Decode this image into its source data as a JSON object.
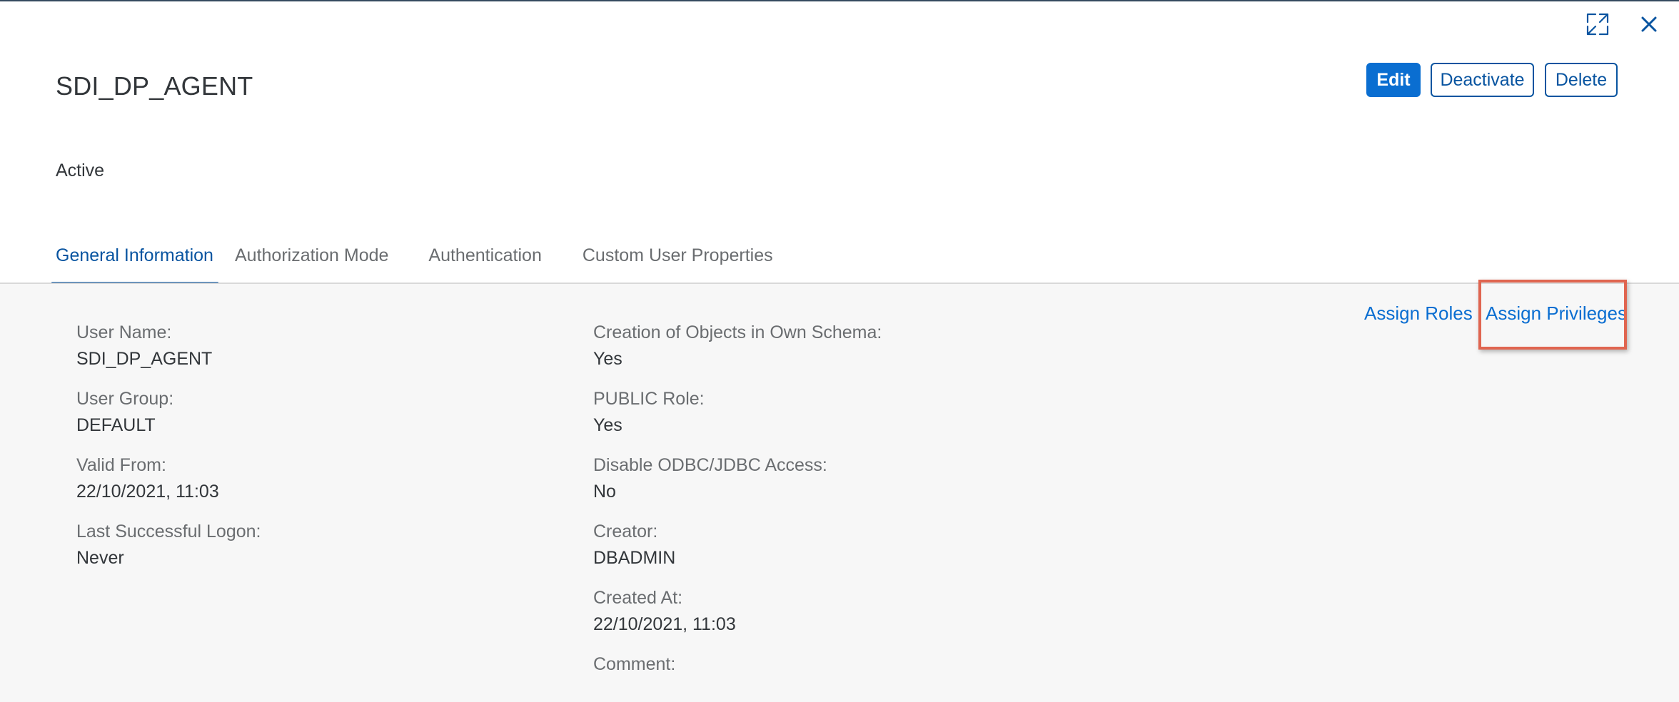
{
  "header": {
    "title": "SDI_DP_AGENT",
    "status": "Active",
    "buttons": {
      "edit": "Edit",
      "deactivate": "Deactivate",
      "delete": "Delete"
    },
    "icons": {
      "fullscreen": "fullscreen-exit-icon",
      "close": "close-icon"
    }
  },
  "tabs": [
    {
      "label": "General Information",
      "active": true
    },
    {
      "label": "Authorization Mode",
      "active": false
    },
    {
      "label": "Authentication",
      "active": false
    },
    {
      "label": "Custom User Properties",
      "active": false
    }
  ],
  "actions": {
    "assign_roles": "Assign Roles",
    "assign_privileges": "Assign Privileges"
  },
  "left_fields": [
    {
      "label": "User Name:",
      "value": "SDI_DP_AGENT"
    },
    {
      "label": "User Group:",
      "value": "DEFAULT"
    },
    {
      "label": "Valid From:",
      "value": "22/10/2021, 11:03"
    },
    {
      "label": "Last Successful Logon:",
      "value": "Never"
    }
  ],
  "right_fields": [
    {
      "label": "Creation of Objects in Own Schema:",
      "value": "Yes"
    },
    {
      "label": "PUBLIC Role:",
      "value": "Yes"
    },
    {
      "label": "Disable ODBC/JDBC Access:",
      "value": "No"
    },
    {
      "label": "Creator:",
      "value": "DBADMIN"
    },
    {
      "label": "Created At:",
      "value": "22/10/2021, 11:03"
    },
    {
      "label": "Comment:",
      "value": ""
    }
  ],
  "colors": {
    "accent": "#0a6ed1",
    "link": "#0854a0",
    "highlight": "#e06550",
    "content_bg": "#f7f7f7"
  }
}
